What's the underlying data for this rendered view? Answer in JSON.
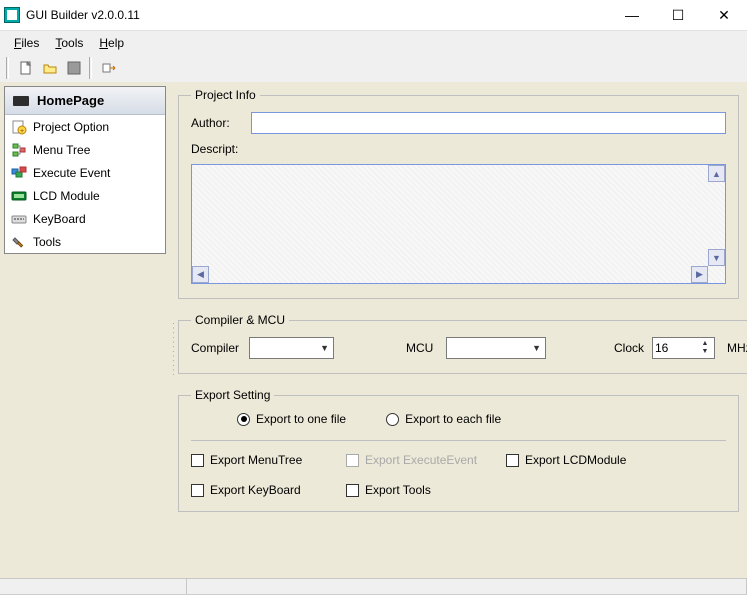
{
  "window": {
    "title": "GUI Builder v2.0.0.11"
  },
  "menu": {
    "files": "Files",
    "tools": "Tools",
    "help": "Help"
  },
  "toolbar_icons": {
    "new": "new-file-icon",
    "open": "open-folder-icon",
    "save": "save-icon",
    "export": "export-icon"
  },
  "sidebar": {
    "header": "HomePage",
    "items": [
      {
        "label": "Project Option"
      },
      {
        "label": "Menu Tree"
      },
      {
        "label": "Execute Event"
      },
      {
        "label": "LCD Module"
      },
      {
        "label": "KeyBoard"
      },
      {
        "label": "Tools"
      }
    ]
  },
  "project_info": {
    "legend": "Project Info",
    "author_label": "Author:",
    "author_value": "",
    "descript_label": "Descript:",
    "descript_value": ""
  },
  "compiler_mcu": {
    "legend": "Compiler & MCU",
    "compiler_label": "Compiler",
    "compiler_value": "",
    "mcu_label": "MCU",
    "mcu_value": "",
    "clock_label": "Clock",
    "clock_value": "16",
    "clock_unit": "MHz"
  },
  "export": {
    "legend": "Export Setting",
    "radio_one": "Export to one file",
    "radio_each": "Export to each file",
    "radio_selected": "one",
    "menutree": "Export MenuTree",
    "execevent": "Export ExecuteEvent",
    "lcdmodule": "Export LCDModule",
    "keyboard": "Export KeyBoard",
    "tools": "Export Tools"
  }
}
